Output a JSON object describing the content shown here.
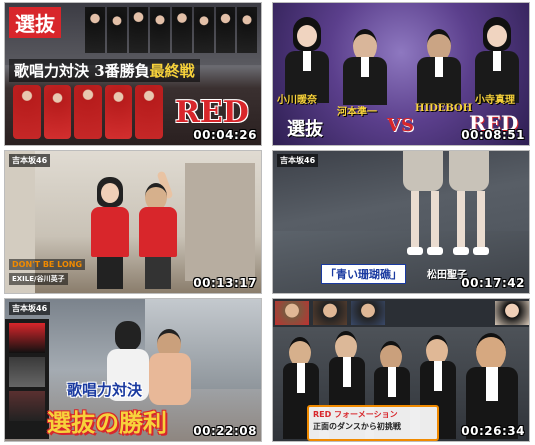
{
  "grid": {
    "thumbnails": [
      {
        "timestamp": "00:04:26",
        "captions": {
          "top": "選抜",
          "headline": "歌唱力対決 3番勝負",
          "headline_accent": "最終戦",
          "logo": "RED"
        }
      },
      {
        "timestamp": "00:08:51",
        "captions": {
          "name_1": "小川暖奈",
          "name_2": "河本準一",
          "name_3": "HIDEBOH",
          "name_4": "小寺真理",
          "team_left": "選抜",
          "vs": "VS",
          "team_right": "RED"
        }
      },
      {
        "timestamp": "00:13:17",
        "captions": {
          "show_logo": "吉本坂46",
          "song": "DON'T BE LONG",
          "artist": "EXILE/谷川英子"
        }
      },
      {
        "timestamp": "00:17:42",
        "captions": {
          "show_logo": "吉本坂46",
          "song": "「青い珊瑚礁」",
          "artist": "松田聖子"
        }
      },
      {
        "timestamp": "00:22:08",
        "captions": {
          "show_logo": "吉本坂46",
          "headline": "歌唱力対決",
          "result": "選抜の勝利"
        }
      },
      {
        "timestamp": "00:26:34",
        "captions": {
          "subtitle_1": "RED フォーメーション",
          "subtitle_2": "正面のダンスから初挑戦"
        }
      }
    ]
  },
  "colors": {
    "red": "#d8262b",
    "purple": "#5b3f8c",
    "gold": "#f7d23b",
    "orange": "#f08a00"
  }
}
